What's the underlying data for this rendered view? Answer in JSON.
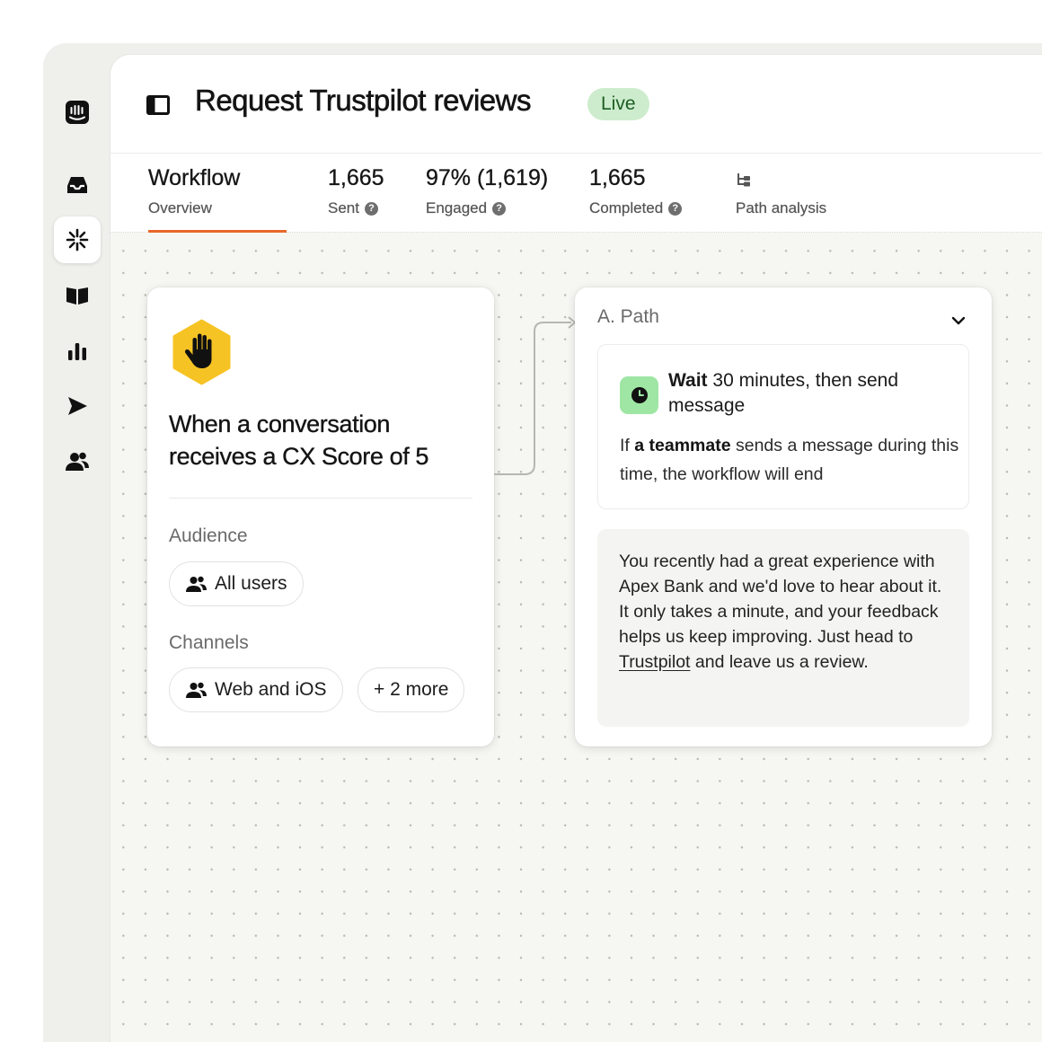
{
  "header": {
    "title": "Request Trustpilot reviews",
    "status": "Live"
  },
  "stats": {
    "workflow": {
      "value": "Workflow",
      "label": "Overview"
    },
    "sent": {
      "value": "1,665",
      "label": "Sent"
    },
    "engaged": {
      "value": "97% (1,619)",
      "label": "Engaged"
    },
    "completed": {
      "value": "1,665",
      "label": "Completed"
    },
    "path_analysis": {
      "label": "Path analysis"
    },
    "help_glyph": "?"
  },
  "trigger": {
    "title": "When a conversation receives a CX Score of 5",
    "audience_label": "Audience",
    "audience_chip": "All users",
    "channels_label": "Channels",
    "channels_chip": "Web and iOS",
    "more_chip": "+ 2 more"
  },
  "path": {
    "header": "A. Path",
    "wait_strong": "Wait",
    "wait_rest": " 30 minutes, then send message",
    "note_prefix": "If ",
    "note_strong": "a teammate",
    "note_rest": " sends a message during this time, the workflow will end",
    "message_before": "You recently had a great experience with Apex Bank and we'd love to hear about it. It only takes a minute, and your feedback helps us keep improving. Just head to ",
    "message_link": "Trustpilot",
    "message_after": " and leave us a review."
  },
  "sidebar": {
    "items": [
      {
        "icon": "intercom-logo-icon"
      },
      {
        "icon": "inbox-icon"
      },
      {
        "icon": "workflow-burst-icon",
        "active": true
      },
      {
        "icon": "book-icon"
      },
      {
        "icon": "bar-chart-icon"
      },
      {
        "icon": "send-icon"
      },
      {
        "icon": "users-icon"
      }
    ]
  },
  "colors": {
    "accent": "#e8682a",
    "live_badge_bg": "#cdeccd",
    "trigger_icon": "#f6c324",
    "clock_bg": "#9fe6a5"
  }
}
